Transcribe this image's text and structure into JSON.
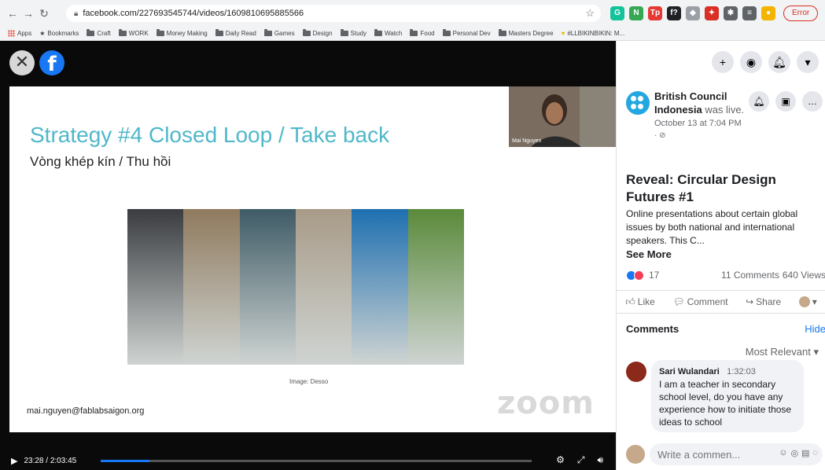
{
  "browser": {
    "url": "facebook.com/227693545744/videos/1609810695885566",
    "error_label": "Error",
    "bookmarks": [
      "Apps",
      "Bookmarks",
      "Craft",
      "WORK",
      "Money Making",
      "Daily Read",
      "Games",
      "Design",
      "Study",
      "Watch",
      "Food",
      "Personal Dev",
      "Masters Degree",
      "#LLBIKINBIKIN: M..."
    ],
    "extensions": [
      {
        "icon": "grammarly-icon",
        "color": "#15c39a",
        "text": "G"
      },
      {
        "icon": "extension-n-icon",
        "color": "#34a853",
        "text": "N"
      },
      {
        "icon": "extension-tp-icon",
        "color": "#e53935",
        "text": "Tp"
      },
      {
        "icon": "formula-icon",
        "color": "#202124",
        "text": "f?"
      },
      {
        "icon": "extension-grey-icon",
        "color": "#9aa0a6",
        "text": "◆"
      },
      {
        "icon": "extension-red-icon",
        "color": "#d93025",
        "text": "✦"
      },
      {
        "icon": "puzzle-icon",
        "color": "#5f6368",
        "text": "✱"
      },
      {
        "icon": "reading-list-icon",
        "color": "#5f6368",
        "text": "≡"
      },
      {
        "icon": "profile-icon",
        "color": "#f4b400",
        "text": "●"
      }
    ]
  },
  "video": {
    "slide_title": "Strategy #4 Closed Loop / Take back",
    "slide_subtitle": "Vòng khép kín / Thu hồi",
    "image_caption": "Image: Desso",
    "email": "mai.nguyen@fablabsaigon.org",
    "watermark": "zoom",
    "speaker_name": "Mai Nguyen",
    "time": "23:28 / 2:03:45",
    "progress_percent": 11.3,
    "collage_colors": [
      "#3a3c40",
      "#8f7a5e",
      "#3f5b66",
      "#a89b88",
      "#1e6fb0",
      "#5a8a3a"
    ]
  },
  "panel": {
    "page_name": "British Council Indonesia",
    "page_status": "was live.",
    "post_time": "October 13 at 7:04 PM",
    "post_privacy": "· ⊘",
    "video_title": "Reveal: Circular Design Futures #1",
    "description": "Online presentations about certain global issues by both national and international speakers. This C...",
    "see_more": "See More",
    "reaction_count": "17",
    "comments_count": "11 Comments",
    "views_count": "640 Views",
    "actions": {
      "like": "Like",
      "comment": "Comment",
      "share": "Share"
    },
    "comments_label": "Comments",
    "hide_label": "Hide",
    "sort_label": "Most Relevant",
    "comment": {
      "author": "Sari Wulandari",
      "time": "1:32:03",
      "text": "I am a teacher in secondary school level, do you have any experience how to initiate those ideas to school"
    },
    "write_placeholder": "Write a commen..."
  }
}
